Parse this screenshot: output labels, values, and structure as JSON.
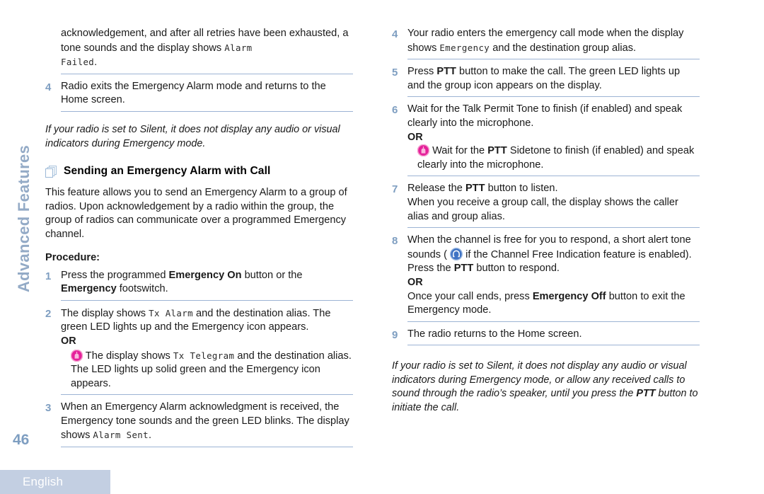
{
  "page": {
    "number": "46",
    "chapter_tab": "Advanced Features",
    "language_tab": "English"
  },
  "left_column": {
    "continued_step": {
      "text_before_lcd": "acknowledgement, and after all retries have been exhausted, a tone sounds and the display shows ",
      "lcd_1": "Alarm",
      "lcd_2": "Failed",
      "text_after_lcd": "."
    },
    "step_4": {
      "number": "4",
      "text": "Radio exits the Emergency Alarm mode and returns to the Home screen."
    },
    "note_1": "If your radio is set to Silent, it does not display any audio or visual indicators during Emergency mode.",
    "section": {
      "icon": "stacked-pages-icon",
      "title": "Sending an Emergency Alarm with Call",
      "intro": "This feature allows you to send an Emergency Alarm to a group of radios. Upon acknowledgement by a radio within the group, the group of radios can communicate over a programmed Emergency channel.",
      "procedure_label": "Procedure:"
    },
    "steps": [
      {
        "number": "1",
        "parts": [
          {
            "type": "text",
            "value": "Press the programmed "
          },
          {
            "type": "bold",
            "value": "Emergency On"
          },
          {
            "type": "text",
            "value": " button or the "
          },
          {
            "type": "bold",
            "value": "Emergency"
          },
          {
            "type": "text",
            "value": " footswitch."
          }
        ]
      },
      {
        "number": "2",
        "parts": [
          {
            "type": "text",
            "value": "The display shows "
          },
          {
            "type": "lcd",
            "value": "Tx Alarm"
          },
          {
            "type": "text",
            "value": " and the destination alias. The green LED lights up and the Emergency icon appears."
          }
        ],
        "or_label": "OR",
        "alt": {
          "icon": "pink-radio-icon",
          "parts": [
            {
              "type": "text",
              "value": "The display shows "
            },
            {
              "type": "lcd",
              "value": "Tx Telegram"
            },
            {
              "type": "text",
              "value": " and the destination alias. The LED lights up solid green and the Emergency icon appears."
            }
          ]
        }
      },
      {
        "number": "3",
        "parts": [
          {
            "type": "text",
            "value": "When an Emergency Alarm acknowledgment is received, the Emergency tone sounds and the green LED blinks. The display shows "
          },
          {
            "type": "lcd",
            "value": "Alarm Sent"
          },
          {
            "type": "text",
            "value": "."
          }
        ]
      }
    ]
  },
  "right_column": {
    "steps": [
      {
        "number": "4",
        "parts": [
          {
            "type": "text",
            "value": "Your radio enters the emergency call mode when the display shows "
          },
          {
            "type": "lcd",
            "value": "Emergency"
          },
          {
            "type": "text",
            "value": " and the destination group alias."
          }
        ]
      },
      {
        "number": "5",
        "parts": [
          {
            "type": "text",
            "value": "Press "
          },
          {
            "type": "bold",
            "value": "PTT"
          },
          {
            "type": "text",
            "value": " button to make the call. The green LED lights up and the group icon appears on the display."
          }
        ]
      },
      {
        "number": "6",
        "parts": [
          {
            "type": "text",
            "value": "Wait for the Talk Permit Tone to finish (if enabled) and speak clearly into the microphone."
          }
        ],
        "or_label": "OR",
        "alt": {
          "icon": "pink-radio-icon",
          "parts": [
            {
              "type": "text",
              "value": "Wait for the "
            },
            {
              "type": "bold",
              "value": "PTT"
            },
            {
              "type": "text",
              "value": " Sidetone to finish (if enabled) and speak clearly into the microphone."
            }
          ]
        }
      },
      {
        "number": "7",
        "parts": [
          {
            "type": "text",
            "value": "Release the "
          },
          {
            "type": "bold",
            "value": "PTT"
          },
          {
            "type": "text",
            "value": " button to listen."
          },
          {
            "type": "break"
          },
          {
            "type": "text",
            "value": "When you receive a group call, the display shows the caller alias and group alias."
          }
        ]
      },
      {
        "number": "8",
        "parts": [
          {
            "type": "text",
            "value": "When the channel is free for you to respond, a short alert tone sounds ( "
          },
          {
            "type": "icon",
            "value": "blue-channel-free-icon"
          },
          {
            "type": "text",
            "value": " if the Channel Free Indication feature is enabled). Press the "
          },
          {
            "type": "bold",
            "value": "PTT"
          },
          {
            "type": "text",
            "value": " button to respond."
          }
        ],
        "or_label": "OR",
        "alt_plain": [
          {
            "type": "text",
            "value": "Once your call ends, press "
          },
          {
            "type": "bold",
            "value": "Emergency Off"
          },
          {
            "type": "text",
            "value": " button to exit the Emergency mode."
          }
        ]
      },
      {
        "number": "9",
        "parts": [
          {
            "type": "text",
            "value": "The radio returns to the Home screen."
          }
        ]
      }
    ],
    "note_1_parts": [
      {
        "type": "text",
        "value": "If your radio is set to Silent, it does not display any audio or visual indicators during Emergency mode, or allow any received calls to sound through the radio’s speaker, until you press the "
      },
      {
        "type": "bold",
        "value": "PTT"
      },
      {
        "type": "text",
        "value": " button to initiate the call."
      }
    ]
  },
  "colors": {
    "rule": "#9cb3d4",
    "step_number": "#7e9ec1",
    "chapter_tab": "#93aac6",
    "footer_tab_bg": "#c3cfe2",
    "footer_tab_text": "#ffffff",
    "icon_pink": "#e5219a",
    "icon_blue": "#3f73c4",
    "body_text": "#1a1a1a"
  }
}
